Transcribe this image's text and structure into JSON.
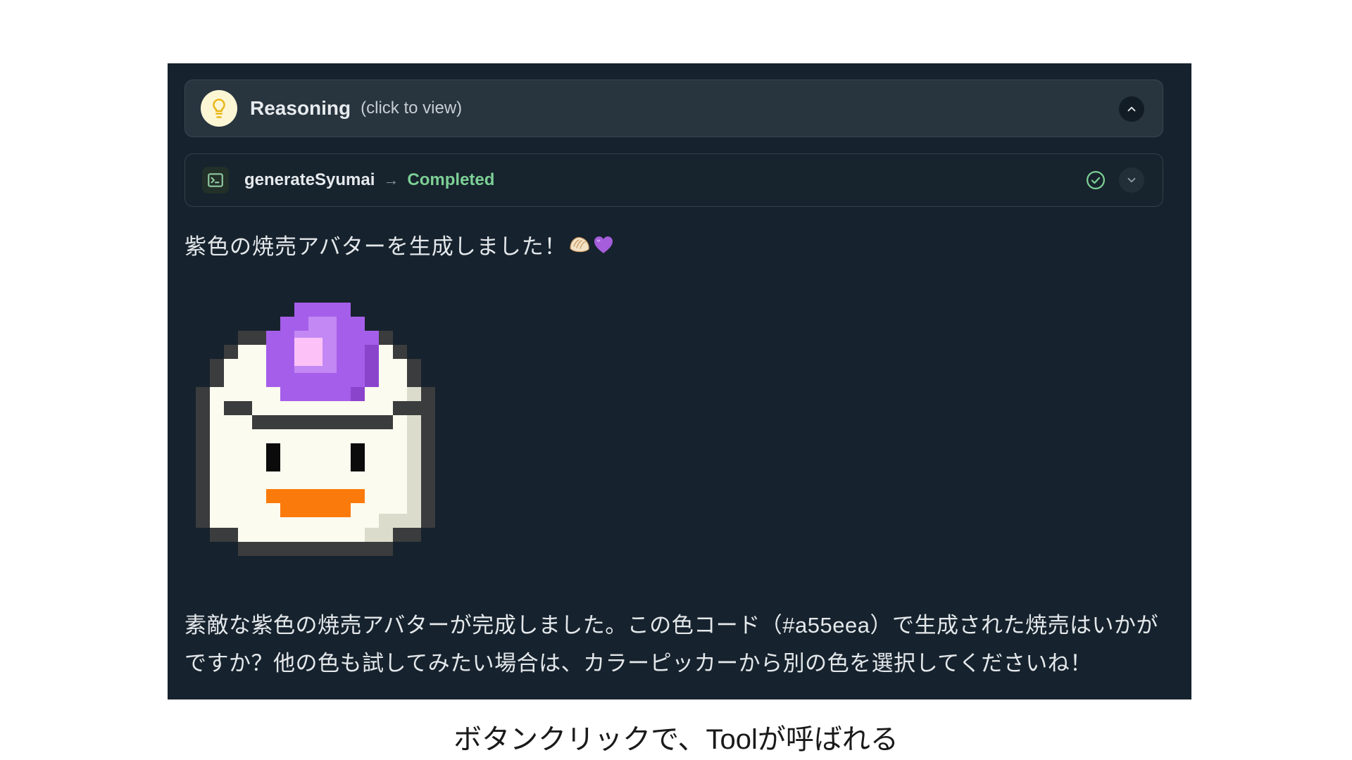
{
  "reasoning": {
    "title": "Reasoning",
    "hint": "(click to view)",
    "icon": "lightbulb-icon"
  },
  "tool": {
    "name": "generateSyumai",
    "arrow": "→",
    "status": "Completed",
    "icon": "terminal-icon"
  },
  "messages": {
    "first": "紫色の焼売アバターを生成しました！",
    "first_emojis": [
      "dumpling-emoji",
      "purple-heart-emoji"
    ],
    "second": "素敵な紫色の焼売アバターが完成しました。この色コード（#a55eea）で生成された焼売はいかがですか？他の色も試してみたい場合は、カラーピッカーから別の色を選択してくださいね！"
  },
  "avatar": {
    "accent_color": "#a55eea",
    "body_color": "#fbfbef",
    "mouth_color": "#fb7a0c"
  },
  "caption": "ボタンクリックで、Toolが呼ばれる",
  "colors": {
    "panel_bg": "#16222d",
    "status_green": "#7ccf95",
    "bulb_yellow": "#e9b516"
  }
}
